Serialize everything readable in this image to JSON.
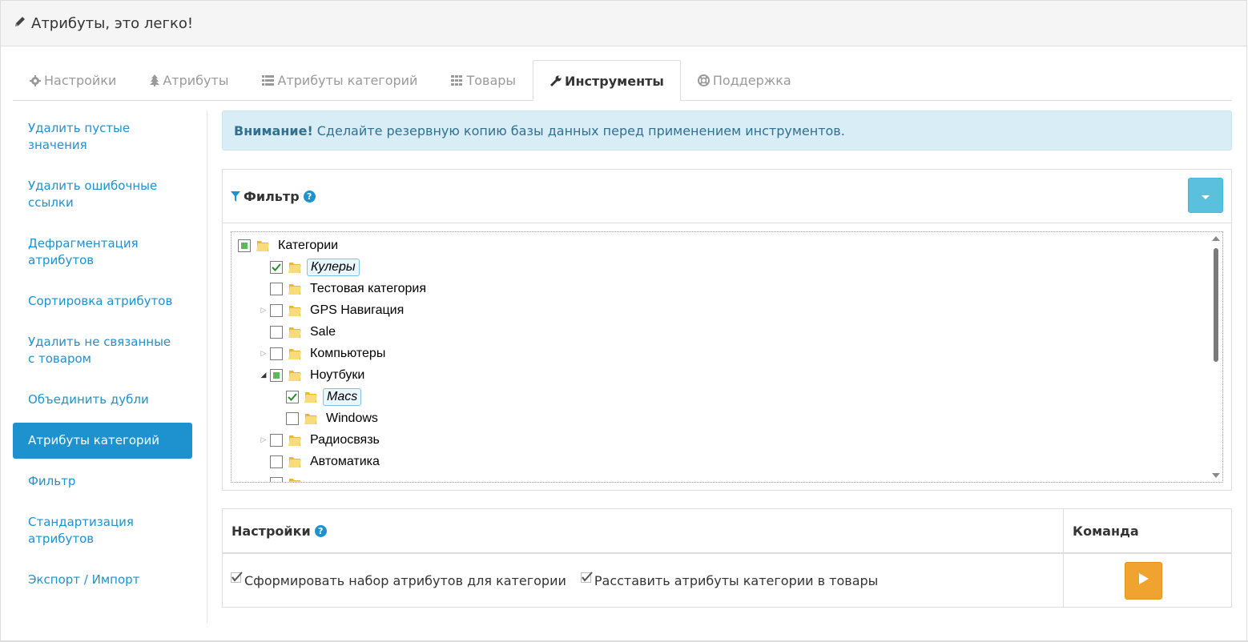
{
  "header": {
    "title": "Атрибуты, это легко!"
  },
  "tabs": [
    {
      "label": "Настройки",
      "icon": "gear-icon"
    },
    {
      "label": "Атрибуты",
      "icon": "tree-icon"
    },
    {
      "label": "Атрибуты категорий",
      "icon": "list-icon"
    },
    {
      "label": "Товары",
      "icon": "grid-icon"
    },
    {
      "label": "Инструменты",
      "icon": "wrench-icon",
      "active": true
    },
    {
      "label": "Поддержка",
      "icon": "lifebuoy-icon"
    }
  ],
  "sidebar": {
    "items": [
      {
        "label": "Удалить пустые значения"
      },
      {
        "label": "Удалить ошибочные ссылки"
      },
      {
        "label": "Дефрагментация атрибутов"
      },
      {
        "label": "Сортировка атрибутов"
      },
      {
        "label": "Удалить не связанные с товаром"
      },
      {
        "label": "Объединить дубли"
      },
      {
        "label": "Атрибуты категорий",
        "active": true
      },
      {
        "label": "Фильтр"
      },
      {
        "label": "Стандартизация атрибутов"
      },
      {
        "label": "Экспорт / Импорт"
      }
    ]
  },
  "alert": {
    "strong": "Внимание!",
    "text": "Сделайте резервную копию базы данных перед применением инструментов."
  },
  "filter": {
    "title": "Фильтр",
    "help": "?",
    "tree": [
      {
        "label": "Категории",
        "state": "partial",
        "expander": "",
        "level": 0
      },
      {
        "label": "Кулеры",
        "state": "checked",
        "expander": "",
        "level": 1,
        "selected": true
      },
      {
        "label": "Тестовая категория",
        "state": "unchecked",
        "expander": "",
        "level": 1
      },
      {
        "label": "GPS Навигация",
        "state": "unchecked",
        "expander": "collapsed",
        "level": 1
      },
      {
        "label": "Sale",
        "state": "unchecked",
        "expander": "",
        "level": 1
      },
      {
        "label": "Компьютеры",
        "state": "unchecked",
        "expander": "collapsed",
        "level": 1
      },
      {
        "label": "Ноутбуки",
        "state": "partial",
        "expander": "expanded",
        "level": 1
      },
      {
        "label": "Macs",
        "state": "checked",
        "expander": "",
        "level": 2,
        "selected": true
      },
      {
        "label": "Windows",
        "state": "unchecked",
        "expander": "",
        "level": 2
      },
      {
        "label": "Радиосвязь",
        "state": "unchecked",
        "expander": "collapsed",
        "level": 1
      },
      {
        "label": "Автоматика",
        "state": "unchecked",
        "expander": "",
        "level": 1
      },
      {
        "label": "",
        "state": "unchecked",
        "expander": "",
        "level": 1
      }
    ]
  },
  "settings": {
    "title": "Настройки",
    "help": "?",
    "command_title": "Команда",
    "options": [
      {
        "label": "Сформировать набор атрибутов для категории",
        "checked": true
      },
      {
        "label": "Расставить атрибуты категории в товары",
        "checked": true
      }
    ]
  },
  "colors": {
    "accent": "#1e91cf",
    "info_bg": "#d9edf7",
    "run_button": "#f0a32f",
    "dropdown_button": "#5bc0de"
  }
}
